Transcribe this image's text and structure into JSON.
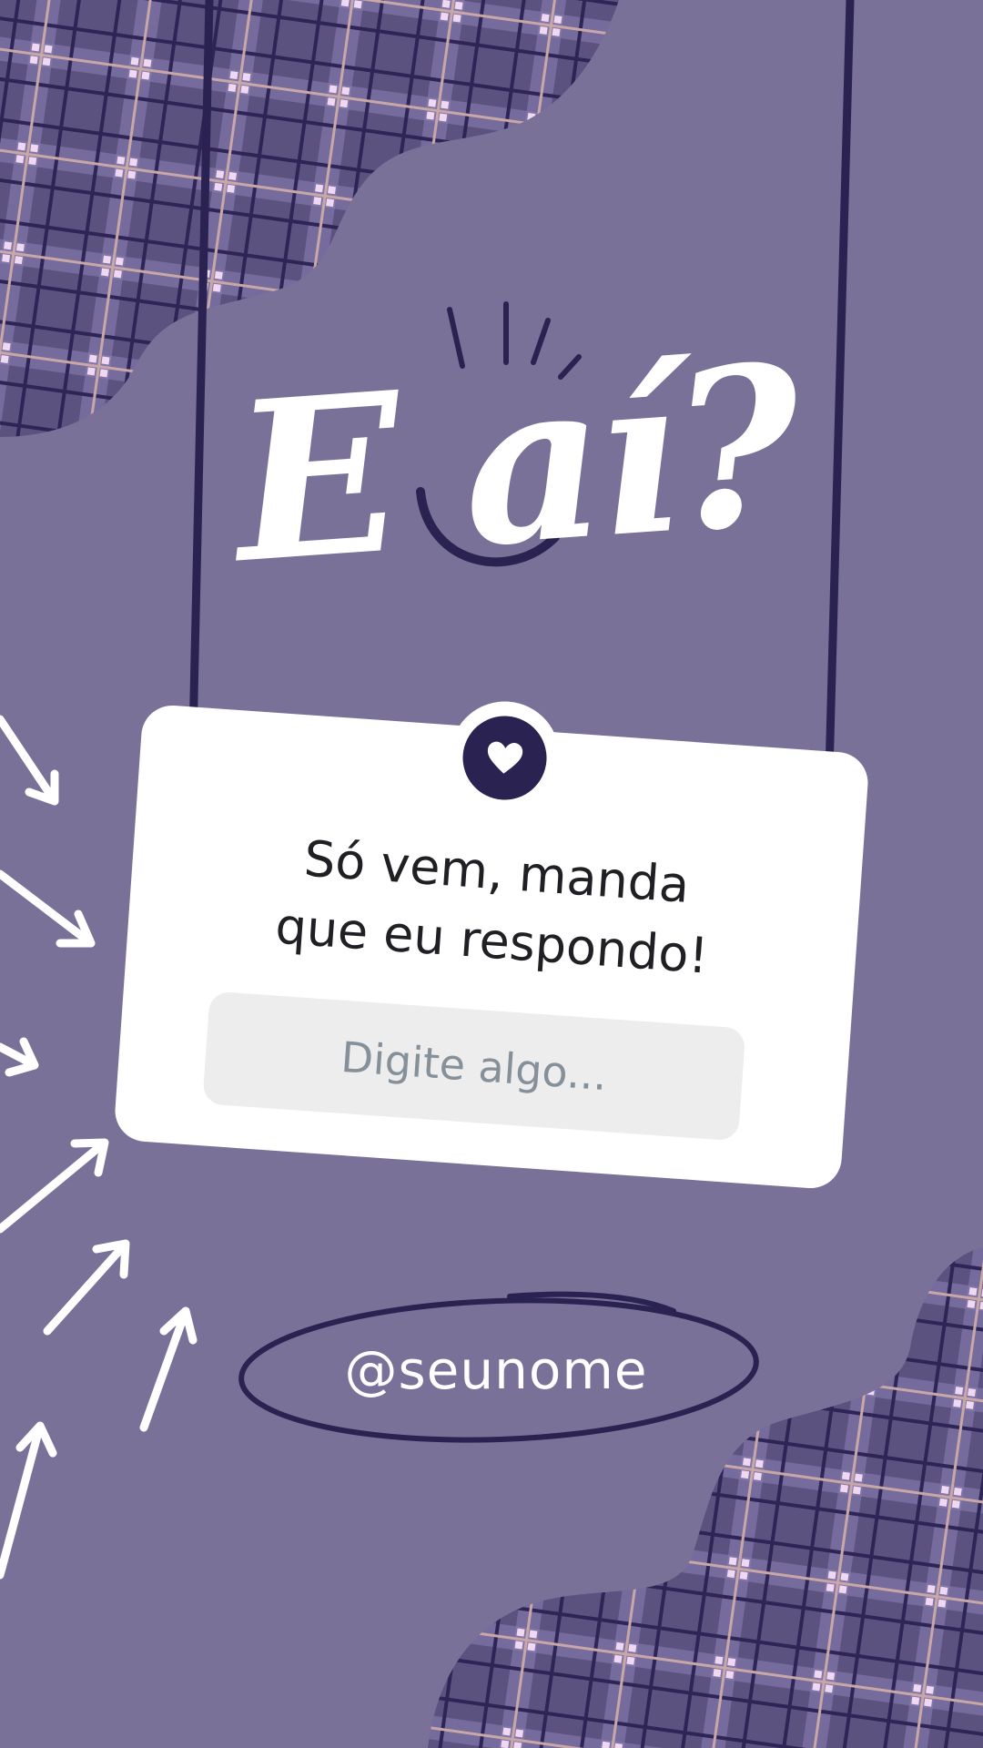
{
  "colors": {
    "background": "#7a7199",
    "plaid_base": "#5b5280",
    "accent_dark": "#2a2250",
    "card": "#ffffff",
    "field": "#ededee",
    "placeholder": "#859099",
    "text_dark": "#1f1f24",
    "white": "#ffffff"
  },
  "title": {
    "text": "E aí?"
  },
  "card": {
    "icon": "heart-icon",
    "prompt_line_1": "Só vem, manda",
    "prompt_line_2": "que eu respondo!",
    "answer_placeholder": "Digite algo..."
  },
  "footer": {
    "handle": "@seunome"
  }
}
